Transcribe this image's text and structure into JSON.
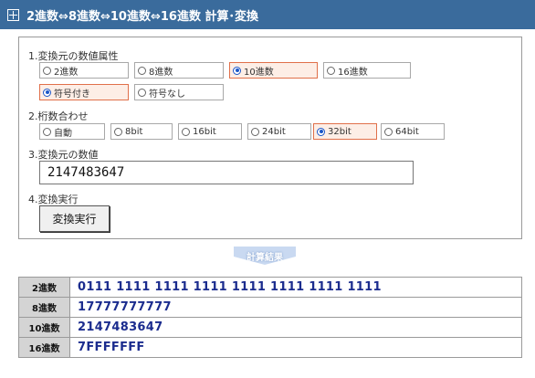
{
  "header": {
    "title": "2進数⇔8進数⇔10進数⇔16進数 計算･変換"
  },
  "form": {
    "attr": {
      "label": "1.変換元の数値属性",
      "bases": [
        "2進数",
        "8進数",
        "10進数",
        "16進数"
      ],
      "selected_base": "10進数",
      "signs": [
        "符号付き",
        "符号なし"
      ],
      "selected_sign": "符号付き"
    },
    "digits": {
      "label": "2.桁数合わせ",
      "options": [
        "自動",
        "8bit",
        "16bit",
        "24bit",
        "32bit",
        "64bit"
      ],
      "selected": "32bit"
    },
    "value": {
      "label": "3.変換元の数値",
      "current": "2147483647"
    },
    "exec": {
      "label": "4.変換実行",
      "button": "変換実行"
    }
  },
  "result": {
    "badge": "計算結果",
    "rows": [
      {
        "label": "2進数",
        "value": "0111 1111 1111 1111 1111 1111 1111 1111"
      },
      {
        "label": "8進数",
        "value": "17777777777"
      },
      {
        "label": "10進数",
        "value": "2147483647"
      },
      {
        "label": "16進数",
        "value": "7FFFFFFF"
      }
    ]
  }
}
